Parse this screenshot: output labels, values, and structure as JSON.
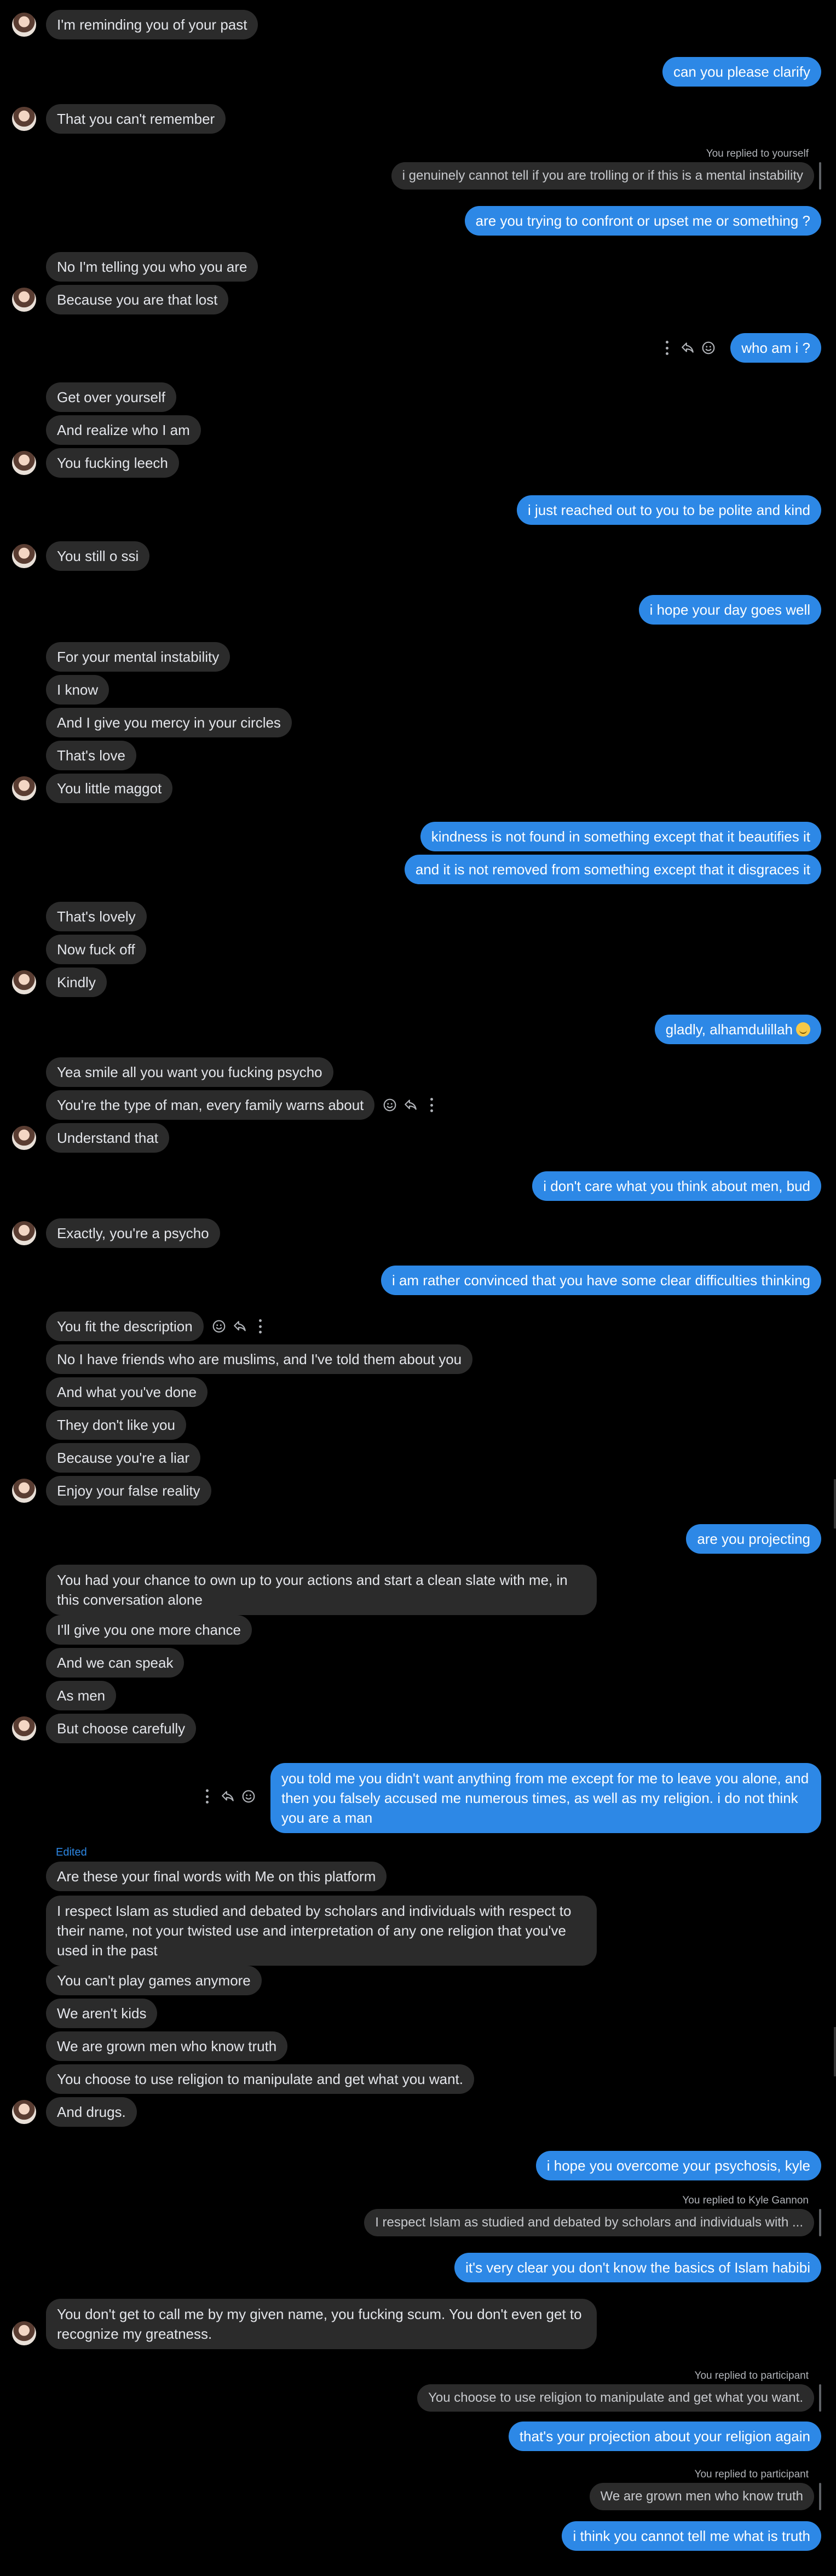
{
  "messages": [
    {
      "dir": "in",
      "text": "I'm reminding you of your past",
      "avatar": true
    },
    {
      "dir": "out",
      "text": "can you please clarify"
    },
    {
      "dir": "in",
      "text": "That you can't remember",
      "avatar": true
    },
    {
      "dir": "meta",
      "text": "You replied to yourself"
    },
    {
      "dir": "quote",
      "text": "i genuinely cannot tell if you are trolling or if this is a mental instability"
    },
    {
      "dir": "out",
      "text": "are you trying to confront or upset me or something ?"
    },
    {
      "dir": "in",
      "text": "No I'm telling you who you are"
    },
    {
      "dir": "in",
      "text": "Because you are that lost",
      "avatar": true
    },
    {
      "dir": "out",
      "text": "who am i ?",
      "actions": true
    },
    {
      "dir": "in",
      "text": "Get over yourself"
    },
    {
      "dir": "in",
      "text": "And realize who I am"
    },
    {
      "dir": "in",
      "text": "You fucking leech",
      "avatar": true
    },
    {
      "dir": "out",
      "text": "i just reached out to you to be polite and kind"
    },
    {
      "dir": "in",
      "text": "You still o ssi",
      "avatar": true
    },
    {
      "dir": "out",
      "text": "i hope your day goes well"
    },
    {
      "dir": "in",
      "text": "For your mental instability"
    },
    {
      "dir": "in",
      "text": "I know"
    },
    {
      "dir": "in",
      "text": "And I give you mercy in your circles"
    },
    {
      "dir": "in",
      "text": "That's love"
    },
    {
      "dir": "in",
      "text": "You little maggot",
      "avatar": true
    },
    {
      "dir": "out",
      "text": "kindness is not found in something except that it beautifies it"
    },
    {
      "dir": "out",
      "text": "and it is not removed from something except that it disgraces it"
    },
    {
      "dir": "in",
      "text": "That's lovely"
    },
    {
      "dir": "in",
      "text": "Now fuck off"
    },
    {
      "dir": "in",
      "text": "Kindly",
      "avatar": true
    },
    {
      "dir": "out",
      "text": "gladly, alhamdulillah",
      "emoji": true
    },
    {
      "dir": "in",
      "text": "Yea smile all you want you fucking psycho"
    },
    {
      "dir": "in",
      "text": "You're the type of man, every family warns about",
      "actions": true
    },
    {
      "dir": "in",
      "text": "Understand that",
      "avatar": true
    },
    {
      "dir": "out",
      "text": "i don't care what you think about men, bud"
    },
    {
      "dir": "in",
      "text": "Exactly, you're a psycho",
      "avatar": true
    },
    {
      "dir": "out",
      "text": "i am rather convinced that you have some clear difficulties thinking"
    },
    {
      "dir": "in",
      "text": "You fit the description",
      "actions": true
    },
    {
      "dir": "in",
      "text": "No I have friends who are muslims, and I've told them about you"
    },
    {
      "dir": "in",
      "text": "And what you've done"
    },
    {
      "dir": "in",
      "text": "They don't like you"
    },
    {
      "dir": "in",
      "text": "Because you're a liar"
    },
    {
      "dir": "in",
      "text": "Enjoy your false reality",
      "avatar": true
    },
    {
      "dir": "out",
      "text": "are you projecting"
    },
    {
      "dir": "in",
      "text": "You had your chance to own up to your actions and start a clean slate with me, in this conversation alone",
      "ml": true
    },
    {
      "dir": "in",
      "text": "I'll give you one more chance"
    },
    {
      "dir": "in",
      "text": "And we can speak"
    },
    {
      "dir": "in",
      "text": "As men"
    },
    {
      "dir": "in",
      "text": "But choose carefully",
      "avatar": true
    },
    {
      "dir": "out",
      "text": "you told me you didn't want anything from me except for me to leave you alone, and then you falsely accused me numerous times, as well as my religion. i do not think you are a man",
      "ml": true,
      "actions": true
    },
    {
      "dir": "edited",
      "text": "Edited"
    },
    {
      "dir": "in",
      "text": "Are these your final words with Me on this platform"
    },
    {
      "dir": "in",
      "text": "I respect Islam as studied and debated by scholars and individuals with respect to their name,  not your twisted use and interpretation of any one religion that you've used in the past",
      "ml": true
    },
    {
      "dir": "in",
      "text": "You can't play games anymore"
    },
    {
      "dir": "in",
      "text": "We aren't kids"
    },
    {
      "dir": "in",
      "text": "We are grown men who know truth"
    },
    {
      "dir": "in",
      "text": "You choose to use religion to manipulate and get what you want."
    },
    {
      "dir": "in",
      "text": "And drugs.",
      "avatar": true
    },
    {
      "dir": "out",
      "text": "i hope you overcome your psychosis, kyle"
    },
    {
      "dir": "meta",
      "text": "You replied to Kyle Gannon"
    },
    {
      "dir": "quote",
      "text": "I respect Islam as studied and debated by scholars and individuals with ..."
    },
    {
      "dir": "out",
      "text": "it's very clear you don't know the basics of Islam habibi"
    },
    {
      "dir": "in",
      "text": "You don't get to call me by my given name, you fucking scum. You don't even get to recognize my greatness.",
      "ml": true,
      "avatar": true
    },
    {
      "dir": "meta",
      "text": "You replied to participant"
    },
    {
      "dir": "quote",
      "text": "You choose to use religion to manipulate and get what you want."
    },
    {
      "dir": "out",
      "text": "that's your projection about your religion again"
    },
    {
      "dir": "meta",
      "text": "You replied to participant"
    },
    {
      "dir": "quote",
      "text": "We are grown men who know truth"
    },
    {
      "dir": "out",
      "text": "i think you cannot tell me what is truth"
    }
  ],
  "icons": {
    "more": "more-icon",
    "reply": "reply-icon",
    "react": "smiley-icon"
  },
  "colors": {
    "incoming": "#2b2b2b",
    "outgoing": "#2d88e6",
    "background": "#000000"
  }
}
